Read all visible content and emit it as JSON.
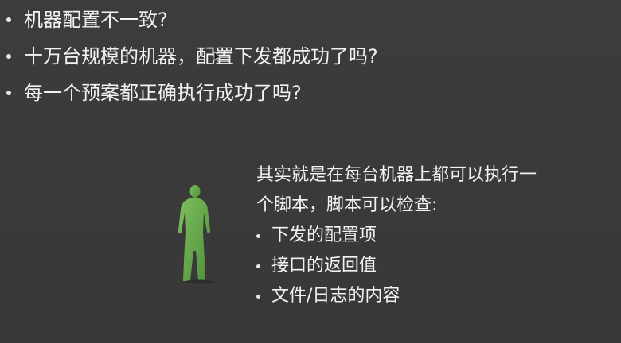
{
  "top_bullets": [
    {
      "text": "机器配置不一致?"
    },
    {
      "text": "十万台规模的机器，配置下发都成功了吗?"
    },
    {
      "text": "每一个预案都正确执行成功了吗?"
    }
  ],
  "right_paragraph": {
    "line1": "其实就是在每台机器上都可以执行一",
    "line2": "个脚本，脚本可以检查:"
  },
  "check_items": [
    {
      "text": "下发的配置项"
    },
    {
      "text": "接口的返回值"
    },
    {
      "text": "文件/日志的内容"
    }
  ],
  "colors": {
    "background": "#3a3a3a",
    "figure": "#6aa84f",
    "text": "#f2f2f2"
  },
  "icons": {
    "figure": "person-silhouette-icon",
    "cursor": "mouse-cursor-icon"
  }
}
